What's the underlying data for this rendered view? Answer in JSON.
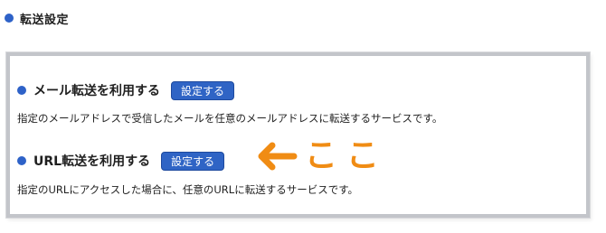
{
  "page": {
    "title": "転送設定"
  },
  "options": {
    "mail": {
      "title": "メール転送を利用する",
      "button_label": "設定する",
      "description": "指定のメールアドレスで受信したメールを任意のメールアドレスに転送するサービスです。"
    },
    "url": {
      "title": "URL転送を利用する",
      "button_label": "設定する",
      "description": "指定のURLにアクセスした場合に、任意のURLに転送するサービスです。"
    }
  },
  "annotation": {
    "text": "ここ",
    "color": "#f08c14"
  },
  "colors": {
    "accent": "#2f64c5",
    "bullet": "#2e62c8",
    "panel_border": "#c3c5ca"
  }
}
